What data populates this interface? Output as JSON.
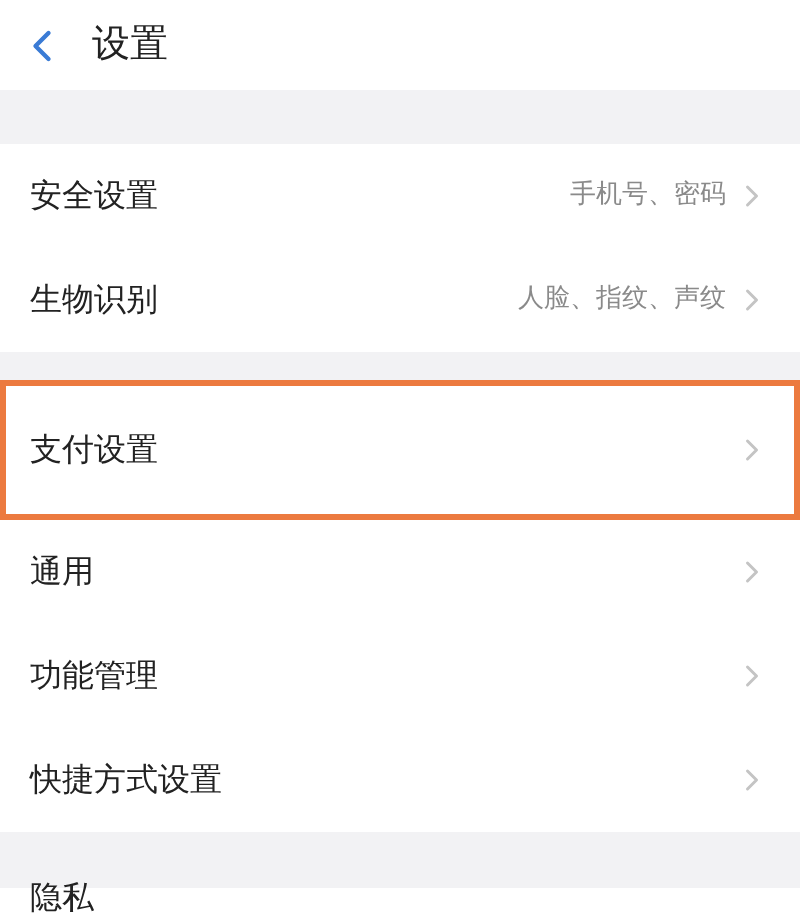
{
  "header": {
    "title": "设置"
  },
  "groups": [
    {
      "items": [
        {
          "label": "安全设置",
          "value": "手机号、密码",
          "highlighted": false
        },
        {
          "label": "生物识别",
          "value": "人脸、指纹、声纹",
          "highlighted": false
        }
      ]
    },
    {
      "items": [
        {
          "label": "支付设置",
          "highlighted": true
        },
        {
          "label": "通用",
          "highlighted": false
        },
        {
          "label": "功能管理",
          "highlighted": false
        },
        {
          "label": "快捷方式设置",
          "highlighted": false
        }
      ]
    },
    {
      "items": [
        {
          "label": "隐私",
          "highlighted": false,
          "partial": true
        }
      ]
    }
  ]
}
